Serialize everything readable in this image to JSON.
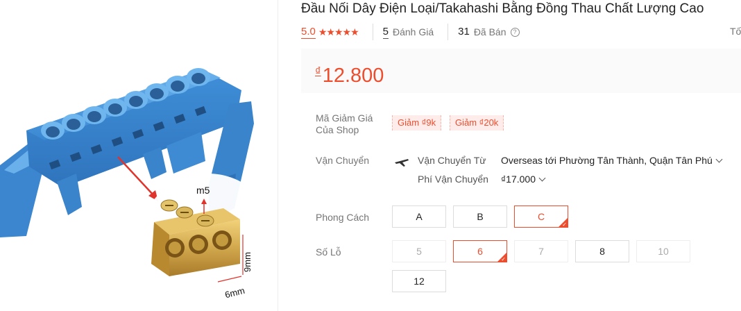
{
  "product": {
    "title": "Đầu Nối Dây Điện Loại/Takahashi Bằng Đồng Thau Chất Lượng Cao",
    "rating_value": "5.0",
    "rating_stars": 5,
    "reviews_count": "5",
    "reviews_label": "Đánh Giá",
    "sold_count": "31",
    "sold_label": "Đã Bán",
    "truncated_right_text": "Tố",
    "currency_symbol": "₫",
    "price": "12.800"
  },
  "image_labels": {
    "screw": "m5",
    "height": "9mm",
    "width": "6mm"
  },
  "voucher": {
    "label": "Mã Giảm Giá Của Shop",
    "items": [
      "Giảm ₫9k",
      "Giảm ₫20k"
    ]
  },
  "shipping": {
    "label": "Vận Chuyển",
    "from_label": "Vận Chuyển Từ",
    "from_value": "Overseas tới Phường Tân Thành, Quận Tân Phú",
    "fee_label": "Phí Vận Chuyển",
    "fee_value": "₫17.000"
  },
  "style": {
    "label": "Phong Cách",
    "options": [
      "A",
      "B",
      "C"
    ],
    "selected": "C"
  },
  "holes": {
    "label": "Số Lỗ",
    "options": [
      "5",
      "6",
      "7",
      "8",
      "10",
      "12"
    ],
    "selected": "6",
    "disabled": [
      "5",
      "7",
      "10"
    ]
  },
  "colors": {
    "accent": "#ee4d2d",
    "product_blue": "#3f8fd8",
    "brass": "#c9a447"
  }
}
